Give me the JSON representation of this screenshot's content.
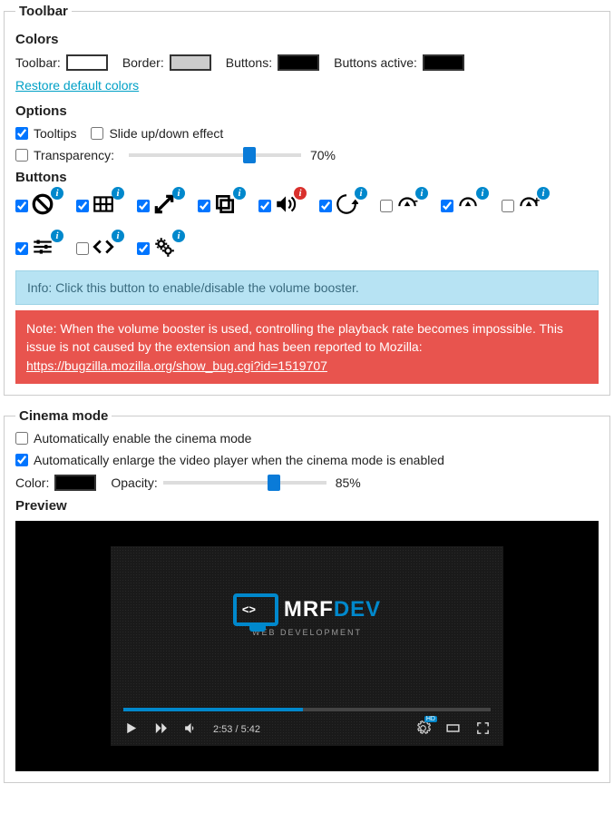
{
  "toolbar": {
    "legend": "Toolbar",
    "colors": {
      "heading": "Colors",
      "toolbar_label": "Toolbar:",
      "toolbar_color": "#ffffff",
      "border_label": "Border:",
      "border_color": "#cccccc",
      "buttons_label": "Buttons:",
      "buttons_color": "#000000",
      "buttons_active_label": "Buttons active:",
      "buttons_active_color": "#000000",
      "restore_link": "Restore default colors"
    },
    "options": {
      "heading": "Options",
      "tooltips_label": "Tooltips",
      "tooltips_checked": true,
      "slide_label": "Slide up/down effect",
      "slide_checked": false,
      "transparency_label": "Transparency:",
      "transparency_checked": false,
      "transparency_value": 70,
      "transparency_display": "70%"
    },
    "buttons_section": {
      "heading": "Buttons",
      "items": [
        {
          "icon": "disable",
          "checked": true,
          "badge": "info"
        },
        {
          "icon": "filmstrip",
          "checked": true,
          "badge": "info"
        },
        {
          "icon": "expand",
          "checked": true,
          "badge": "info"
        },
        {
          "icon": "copy",
          "checked": true,
          "badge": "info"
        },
        {
          "icon": "volume",
          "checked": true,
          "badge": "red"
        },
        {
          "icon": "reload",
          "checked": true,
          "badge": "info"
        },
        {
          "icon": "speed-minus",
          "checked": false,
          "badge": "info"
        },
        {
          "icon": "speedometer",
          "checked": true,
          "badge": "info"
        },
        {
          "icon": "speed-plus",
          "checked": false,
          "badge": "info"
        },
        {
          "icon": "sliders",
          "checked": true,
          "badge": "info"
        },
        {
          "icon": "code",
          "checked": false,
          "badge": "info"
        },
        {
          "icon": "gears",
          "checked": true,
          "badge": "info"
        }
      ]
    },
    "info_text": "Info: Click this button to enable/disable the volume booster.",
    "note_text": "Note: When the volume booster is used, controlling the playback rate becomes impossible. This issue is not caused by the extension and has been reported to Mozilla: ",
    "note_link_text": "https://bugzilla.mozilla.org/show_bug.cgi?id=1519707"
  },
  "cinema": {
    "legend": "Cinema mode",
    "auto_enable_label": "Automatically enable the cinema mode",
    "auto_enable_checked": false,
    "auto_enlarge_label": "Automatically enlarge the video player when the cinema mode is enabled",
    "auto_enlarge_checked": true,
    "color_label": "Color:",
    "color_value": "#000000",
    "opacity_label": "Opacity:",
    "opacity_value": 85,
    "opacity_display": "85%",
    "preview_heading": "Preview",
    "video": {
      "logo_text1": "MRF",
      "logo_text2": "DEV",
      "logo_sub": "WEB DEVELOPMENT",
      "logo_monitor_text": "<>",
      "time_current": "2:53",
      "time_total": "5:42",
      "progress_percent": 49,
      "hd_label": "HD"
    }
  }
}
